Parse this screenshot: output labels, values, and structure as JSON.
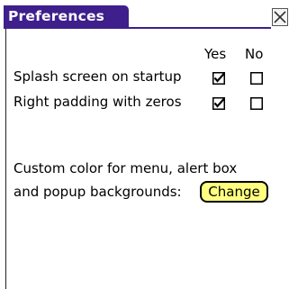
{
  "window": {
    "title": "Preferences",
    "close_icon": "close-icon",
    "accent_color": "#3e1f8c"
  },
  "columns": {
    "yes": "Yes",
    "no": "No"
  },
  "options": [
    {
      "label": "Splash screen on startup",
      "yes_checked": true,
      "no_checked": false
    },
    {
      "label": "Right padding with zeros",
      "yes_checked": true,
      "no_checked": false
    }
  ],
  "custom_color": {
    "line1": "Custom color for menu, alert box",
    "line2": "and popup backgrounds:",
    "button_label": "Change",
    "button_color": "#ffff80"
  }
}
